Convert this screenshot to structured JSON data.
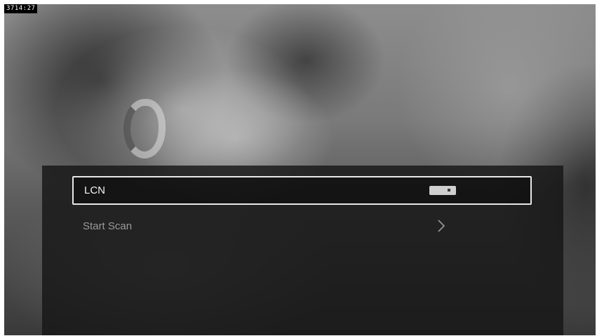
{
  "screen": {
    "timestamp": "3714:27"
  },
  "menu": {
    "items": [
      {
        "label": "LCN",
        "control": "toggle",
        "toggle_state": "on",
        "selected": true
      },
      {
        "label": "Start Scan",
        "control": "chevron-right-icon",
        "selected": false
      }
    ]
  },
  "colors": {
    "selection_border": "#e8e8e8",
    "panel_background": "#161616",
    "selected_text": "#f2f2f2",
    "unselected_text": "#9a9a9a",
    "toggle_track": "#cfcfcf"
  }
}
